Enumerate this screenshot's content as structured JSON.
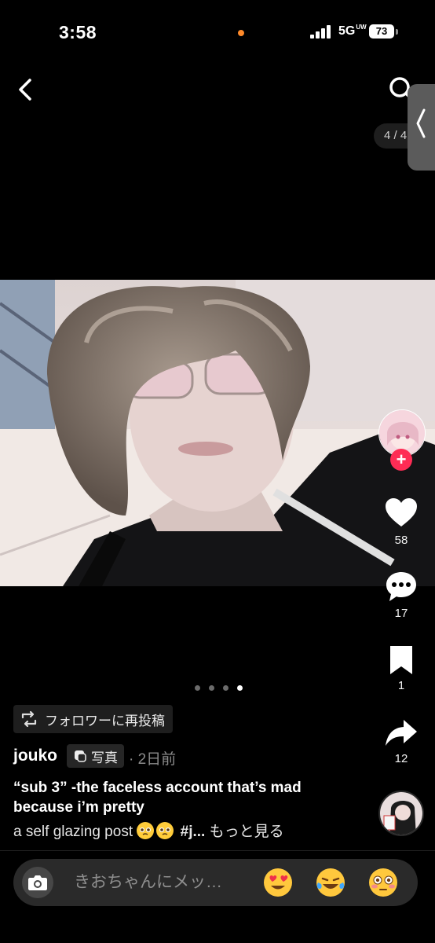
{
  "status_bar": {
    "time": "3:58",
    "network": "5G",
    "network_sub": "UW",
    "battery": "73"
  },
  "nav": {
    "page_counter": "4 / 4",
    "icons": [
      "back-icon",
      "search-icon",
      "edge-panel-handle"
    ]
  },
  "actions": {
    "likes": "58",
    "comments": "17",
    "saves": "1",
    "shares": "12",
    "follow_label": "+"
  },
  "carousel": {
    "total": 4,
    "active_index": 4
  },
  "post": {
    "repost_label": "フォロワーに再投稿",
    "author": "jouko",
    "type_tag": "写真",
    "date": "· 2日前",
    "title": "“sub 3” -the faceless account that’s mad because i’m pretty",
    "body_text": "a self glazing post",
    "hashtag": "#j...",
    "see_more": "もっと見る"
  },
  "comment_bar": {
    "placeholder": "きおちゃんにメッ…",
    "emoji_reactions": [
      "heart-eyes-emoji",
      "laughing-tears-emoji",
      "flushed-emoji"
    ]
  },
  "colors": {
    "background": "#000000",
    "accent": "#fe2c55",
    "status_dot": "#ff8a2a",
    "chip_bg": "#1e1e1e",
    "input_bg": "#2a2a2a"
  }
}
